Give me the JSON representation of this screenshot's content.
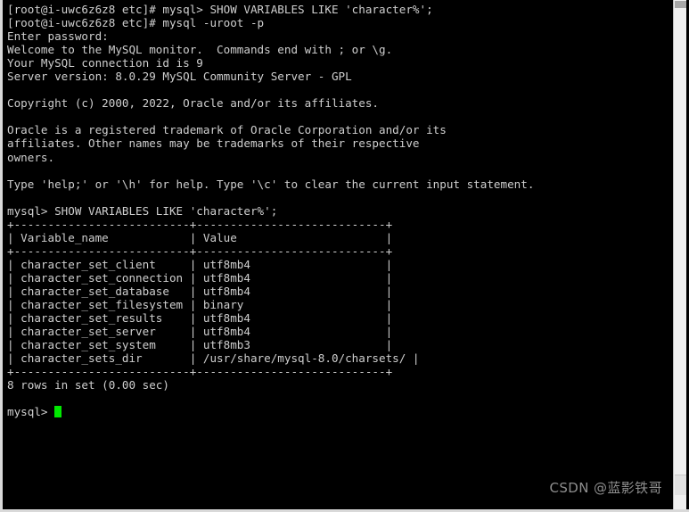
{
  "window": {
    "title": "terminal",
    "background_color": "#000000",
    "text_color": "#cfcfcf",
    "cursor_color": "#00e800"
  },
  "terminal": {
    "lines": [
      "[root@i-uwc6z6z8 etc]# mysql> SHOW VARIABLES LIKE 'character%';",
      "[root@i-uwc6z6z8 etc]# mysql -uroot -p",
      "Enter password:",
      "Welcome to the MySQL monitor.  Commands end with ; or \\g.",
      "Your MySQL connection id is 9",
      "Server version: 8.0.29 MySQL Community Server - GPL",
      "",
      "Copyright (c) 2000, 2022, Oracle and/or its affiliates.",
      "",
      "Oracle is a registered trademark of Oracle Corporation and/or its",
      "affiliates. Other names may be trademarks of their respective",
      "owners.",
      "",
      "Type 'help;' or '\\h' for help. Type '\\c' to clear the current input statement.",
      "",
      "mysql> SHOW VARIABLES LIKE 'character%';",
      "+--------------------------+----------------------------+",
      "| Variable_name            | Value                      |",
      "+--------------------------+----------------------------+",
      "| character_set_client     | utf8mb4                    |",
      "| character_set_connection | utf8mb4                    |",
      "| character_set_database   | utf8mb4                    |",
      "| character_set_filesystem | binary                     |",
      "| character_set_results    | utf8mb4                    |",
      "| character_set_server     | utf8mb4                    |",
      "| character_set_system     | utf8mb3                    |",
      "| character_sets_dir       | /usr/share/mysql-8.0/charsets/ |",
      "+--------------------------+----------------------------+",
      "8 rows in set (0.00 sec)",
      ""
    ],
    "prompt": "mysql> ",
    "session": {
      "user": "root",
      "hostname": "i-uwc6z6z8",
      "directory": "etc",
      "shell_prompt": "[root@i-uwc6z6z8 etc]#",
      "mysql_command": "mysql -uroot -p",
      "password_prompt": "Enter password:",
      "mysql_version": "8.0.29",
      "server_edition": "MySQL Community Server - GPL",
      "connection_id": "9",
      "query": "SHOW VARIABLES LIKE 'character%';",
      "result_footer": "8 rows in set (0.00 sec)"
    },
    "result_table": {
      "columns": [
        "Variable_name",
        "Value"
      ],
      "rows": [
        [
          "character_set_client",
          "utf8mb4"
        ],
        [
          "character_set_connection",
          "utf8mb4"
        ],
        [
          "character_set_database",
          "utf8mb4"
        ],
        [
          "character_set_filesystem",
          "binary"
        ],
        [
          "character_set_results",
          "utf8mb4"
        ],
        [
          "character_set_server",
          "utf8mb4"
        ],
        [
          "character_set_system",
          "utf8mb3"
        ],
        [
          "character_sets_dir",
          "/usr/share/mysql-8.0/charsets/"
        ]
      ],
      "row_count": 8,
      "elapsed": "0.00 sec"
    }
  },
  "scrollbar": {
    "name": "vertical-scrollbar",
    "position": "right"
  },
  "watermark": {
    "text": "CSDN @蓝影铁哥"
  }
}
